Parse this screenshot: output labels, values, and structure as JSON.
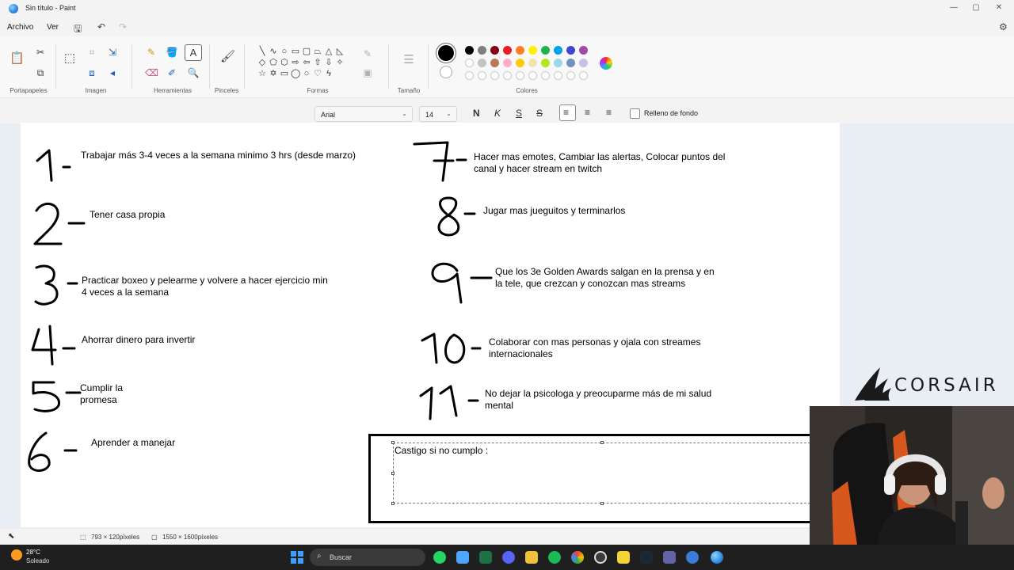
{
  "window": {
    "title": "Sin título - Paint"
  },
  "menu": {
    "file": "Archivo",
    "view": "Ver"
  },
  "ribbon": {
    "groups": {
      "clipboard": "Portapapeles",
      "image": "Imagen",
      "tools": "Herramientas",
      "brushes": "Pinceles",
      "shapes": "Formas",
      "size": "Tamaño",
      "colors": "Colores"
    },
    "colors": {
      "primary": "#000000",
      "secondary": "#ffffff",
      "row1": [
        "#000000",
        "#7f7f7f",
        "#880015",
        "#ed1c24",
        "#ff7f27",
        "#fff200",
        "#22b14c",
        "#00a2e8",
        "#3f48cc",
        "#a349a4"
      ],
      "row2": [
        "#ffffff",
        "#c3c3c3",
        "#b97a57",
        "#ffaec9",
        "#ffc90e",
        "#efe4b0",
        "#b5e61d",
        "#99d9ea",
        "#7092be",
        "#c8bfe7"
      ]
    }
  },
  "text_toolbar": {
    "font": "Arial",
    "size": "14",
    "bold": "N",
    "italic": "K",
    "underline": "S",
    "strike": "S",
    "fill_background": "Relleno de fondo"
  },
  "canvas": {
    "goals": [
      {
        "num": "1",
        "text": "Trabajar más 3-4 veces a la semana minimo 3 hrs (desde marzo)"
      },
      {
        "num": "2",
        "text": "Tener casa propia"
      },
      {
        "num": "3",
        "text": "Practicar boxeo y pelearme y volvere a hacer ejercicio min\n4 veces a la semana"
      },
      {
        "num": "4",
        "text": "Ahorrar dinero para invertir"
      },
      {
        "num": "5",
        "text": "Cumplir la\npromesa"
      },
      {
        "num": "6",
        "text": "Aprender a manejar"
      },
      {
        "num": "7",
        "text": "Hacer mas emotes, Cambiar las alertas, Colocar puntos del\ncanal y hacer stream en twitch"
      },
      {
        "num": "8",
        "text": "Jugar mas jueguitos y terminarlos"
      },
      {
        "num": "9",
        "text": "Que los 3e Golden Awards salgan en la prensa y en\nla tele, que crezcan y conozcan mas streams"
      },
      {
        "num": "10",
        "text": "Colaborar con mas personas y ojala con streames\ninternacionales"
      },
      {
        "num": "11",
        "text": "No dejar la psicologa y preocuparme más de mi salud\nmental"
      }
    ],
    "castigo": "Castigo si no cumplo :"
  },
  "overlay": {
    "brand": "CORSAIR"
  },
  "status": {
    "selection_size": "793 × 120píxeles",
    "canvas_size": "1550 × 1600píxeles"
  },
  "taskbar": {
    "temp": "28°C",
    "weather": "Soleado",
    "search": "Buscar"
  }
}
